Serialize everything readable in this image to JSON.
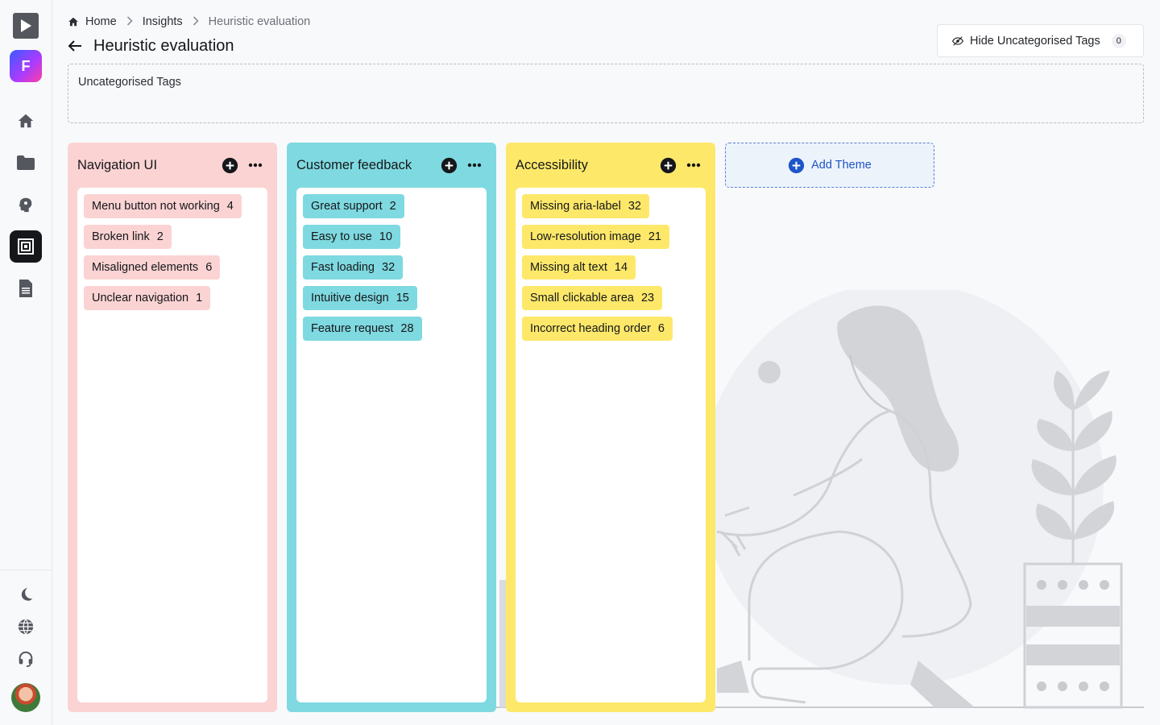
{
  "breadcrumb": {
    "home": "Home",
    "insights": "Insights",
    "current": "Heuristic evaluation"
  },
  "page": {
    "title": "Heuristic evaluation"
  },
  "toolbar": {
    "hide_label": "Hide Uncategorised Tags",
    "hide_count": "0"
  },
  "uncategorised": {
    "label": "Uncategorised Tags"
  },
  "columns": [
    {
      "title": "Navigation UI",
      "color": "#fbd3d3",
      "tag_color": "#fbd3d3",
      "tags": [
        {
          "label": "Menu button not working",
          "count": "4"
        },
        {
          "label": "Broken link",
          "count": "2"
        },
        {
          "label": "Misaligned elements",
          "count": "6"
        },
        {
          "label": "Unclear navigation",
          "count": "1"
        }
      ]
    },
    {
      "title": "Customer feedback",
      "color": "#7fd9e0",
      "tag_color": "#7fd9e0",
      "tags": [
        {
          "label": "Great support",
          "count": "2"
        },
        {
          "label": "Easy to use",
          "count": "10"
        },
        {
          "label": "Fast loading",
          "count": "32"
        },
        {
          "label": "Intuitive design",
          "count": "15"
        },
        {
          "label": "Feature request",
          "count": "28"
        }
      ]
    },
    {
      "title": "Accessibility",
      "color": "#fde86a",
      "tag_color": "#fde86a",
      "tags": [
        {
          "label": "Missing aria-label",
          "count": "32"
        },
        {
          "label": "Low-resolution image",
          "count": "21"
        },
        {
          "label": "Missing alt text",
          "count": "14"
        },
        {
          "label": "Small clickable area",
          "count": "23"
        },
        {
          "label": "Incorrect heading order",
          "count": "6"
        }
      ]
    }
  ],
  "add_theme": {
    "label": "Add Theme"
  },
  "colors": {
    "accent": "#1d55c9",
    "active_nav": "#15171a"
  },
  "icons": {
    "sidebar_top": [
      "play-logo-icon",
      "f-logo-icon",
      "home-icon",
      "folder-icon",
      "brain-icon",
      "board-icon",
      "document-icon"
    ],
    "sidebar_bottom": [
      "moon-icon",
      "globe-icon",
      "headset-icon",
      "avatar"
    ]
  }
}
